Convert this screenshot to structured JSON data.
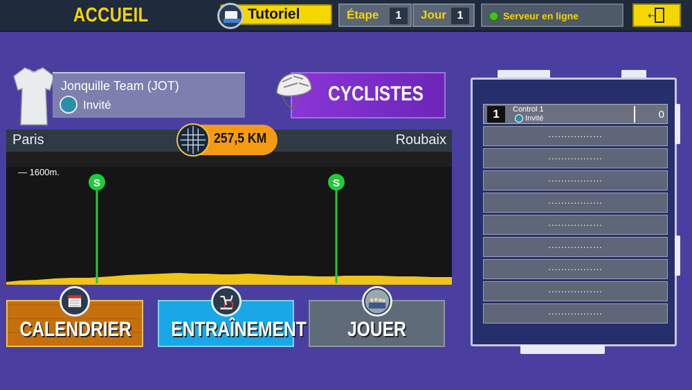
{
  "header": {
    "title": "ACCUEIL",
    "tutorial_label": "Tutoriel",
    "stage_label": "Étape",
    "stage_value": "1",
    "day_label": "Jour",
    "day_value": "1",
    "server_status": "Serveur en ligne",
    "colors": {
      "accent": "#f4d600",
      "bar": "#1f2a3c",
      "online": "#44c21c"
    }
  },
  "team": {
    "name": "Jonquille Team (JOT)",
    "role": "Invité"
  },
  "cyclists_button": {
    "label": "CYCLISTES"
  },
  "race": {
    "start_city": "Paris",
    "finish_city": "Roubaix",
    "distance": "257,5 KM",
    "altitude_marker": "— 1600m.",
    "sprint_marker_label": "S",
    "colors": {
      "profile": "#f0c419",
      "sprint_line": "#22c93a",
      "distance_pill": "#f59b12"
    }
  },
  "actions": {
    "calendar": "CALENDRIER",
    "training": "ENTRAÎNEMENT",
    "play": "JOUER"
  },
  "leaderboard": {
    "first": {
      "rank": "1",
      "name": "Control 1",
      "role": "Invité",
      "score": "0"
    },
    "empty_rows": [
      ".................",
      ".................",
      ".................",
      ".................",
      ".................",
      ".................",
      ".................",
      ".................",
      "................."
    ]
  }
}
